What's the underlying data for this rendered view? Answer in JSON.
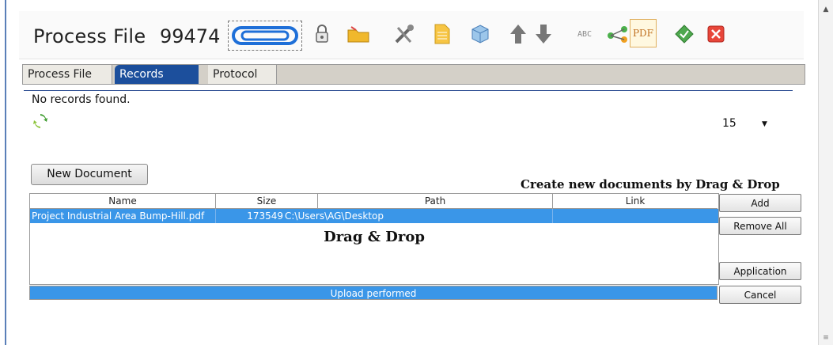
{
  "title": {
    "label": "Process File",
    "number": "99474"
  },
  "toolbar": {
    "icons": [
      "paperclip-icon",
      "lock-icon",
      "folder-icon",
      "tools-icon",
      "document-icon",
      "cube-icon",
      "arrow-up-icon",
      "arrow-down-icon",
      "spellcheck-icon",
      "share-icon",
      "pdf-icon",
      "approve-icon",
      "close-icon"
    ],
    "spellcheck_text": "ABC",
    "pdf_text": "PDF"
  },
  "tabs": {
    "process_file": "Process File",
    "records": "Records",
    "protocol": "Protocol"
  },
  "status": {
    "no_records": "No records found."
  },
  "page_size": {
    "value": "15"
  },
  "buttons": {
    "new_document": "New Document",
    "add": "Add",
    "remove_all": "Remove All",
    "application": "Application",
    "cancel": "Cancel"
  },
  "drop_caption": "Create new documents by Drag & Drop",
  "grid": {
    "columns": {
      "name": "Name",
      "size": "Size",
      "path": "Path",
      "link": "Link"
    },
    "rows": [
      {
        "name": "Project Industrial Area Bump-Hill.pdf",
        "size": "173549",
        "path": "C:\\Users\\AG\\Desktop",
        "link": ""
      }
    ],
    "drop_text": "Drag & Drop"
  },
  "progress": {
    "text": "Upload performed"
  },
  "colors": {
    "accent": "#1c4f9c",
    "selection": "#3a96e8"
  }
}
